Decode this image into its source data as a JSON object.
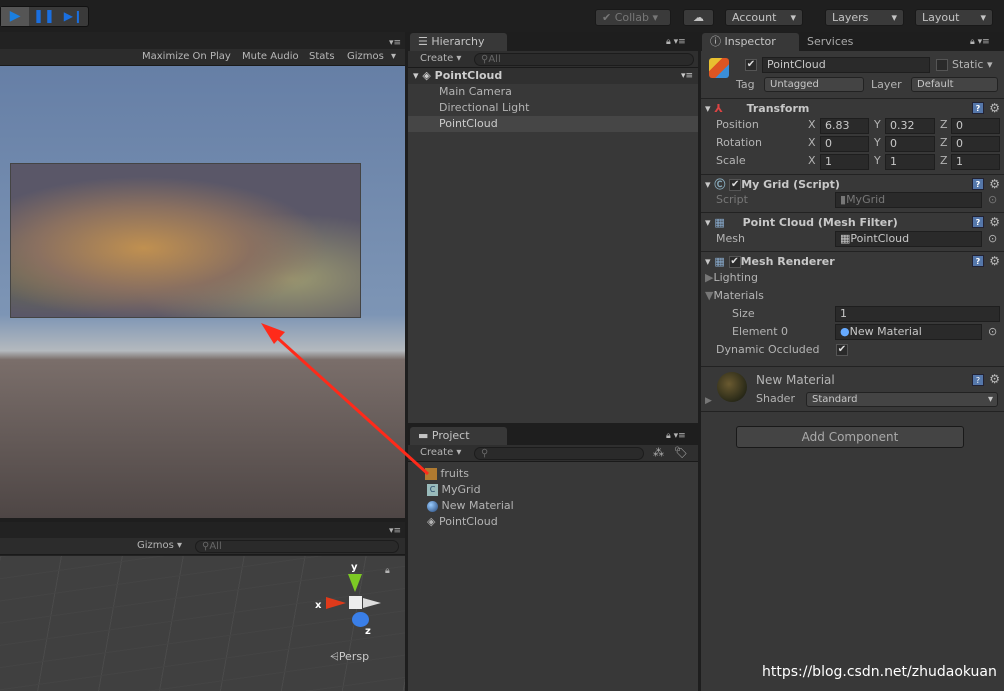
{
  "toolbar": {
    "collab": "Collab",
    "account": "Account",
    "layers": "Layers",
    "layout": "Layout"
  },
  "game": {
    "maximize": "Maximize On Play",
    "mute": "Mute Audio",
    "stats": "Stats",
    "gizmos": "Gizmos"
  },
  "scene": {
    "gizmos": "Gizmos",
    "search_placeholder": "All",
    "axis_x": "x",
    "axis_y": "y",
    "axis_z": "z",
    "persp": "Persp"
  },
  "hierarchy": {
    "tab": "Hierarchy",
    "create": "Create",
    "search_placeholder": "All",
    "scene": "PointCloud",
    "items": [
      "Main Camera",
      "Directional Light",
      "PointCloud"
    ]
  },
  "project": {
    "tab": "Project",
    "create": "Create",
    "items": [
      "fruits",
      "MyGrid",
      "New Material",
      "PointCloud"
    ]
  },
  "inspector": {
    "tab": "Inspector",
    "services": "Services",
    "name": "PointCloud",
    "static": "Static",
    "tag_label": "Tag",
    "tag": "Untagged",
    "layer_label": "Layer",
    "layer": "Default",
    "transform": {
      "title": "Transform",
      "rows": [
        {
          "label": "Position",
          "x": "6.83",
          "y": "0.32",
          "z": "0"
        },
        {
          "label": "Rotation",
          "x": "0",
          "y": "0",
          "z": "0"
        },
        {
          "label": "Scale",
          "x": "1",
          "y": "1",
          "z": "1"
        }
      ]
    },
    "mygrid": {
      "title": "My Grid (Script)",
      "script_label": "Script",
      "script": "MyGrid"
    },
    "meshfilter": {
      "title": "Point Cloud (Mesh Filter)",
      "mesh_label": "Mesh",
      "mesh": "PointCloud"
    },
    "meshrenderer": {
      "title": "Mesh Renderer",
      "lighting": "Lighting",
      "materials": "Materials",
      "size_label": "Size",
      "size": "1",
      "element_label": "Element 0",
      "element": "New Material",
      "dynamic": "Dynamic Occluded"
    },
    "material": {
      "title": "New Material",
      "shader_label": "Shader",
      "shader": "Standard"
    },
    "add_component": "Add Component"
  },
  "watermark": "https://blog.csdn.net/zhudaokuan"
}
